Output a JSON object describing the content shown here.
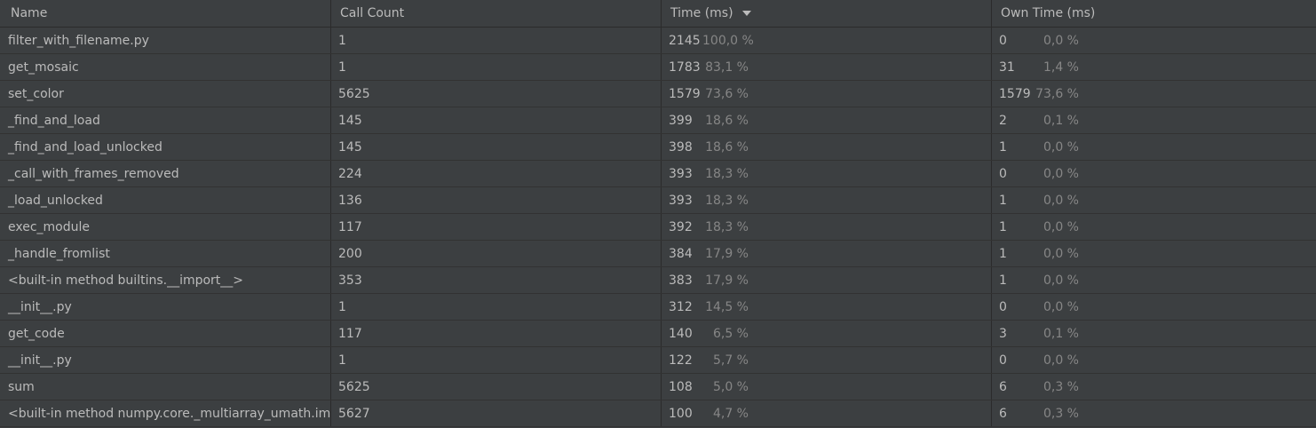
{
  "header": {
    "name": "Name",
    "call_count": "Call Count",
    "time": "Time (ms)",
    "own_time": "Own Time (ms)",
    "sort_icon": "sort-descending-icon"
  },
  "rows": [
    {
      "name": "filter_with_filename.py",
      "call_count": "1",
      "time": "2145",
      "time_pct": "100,0 %",
      "own": "0",
      "own_pct": "0,0 %"
    },
    {
      "name": "get_mosaic",
      "call_count": "1",
      "time": "1783",
      "time_pct": "83,1 %",
      "own": "31",
      "own_pct": "1,4 %"
    },
    {
      "name": "set_color",
      "call_count": "5625",
      "time": "1579",
      "time_pct": "73,6 %",
      "own": "1579",
      "own_pct": "73,6 %"
    },
    {
      "name": "_find_and_load",
      "call_count": "145",
      "time": "399",
      "time_pct": "18,6 %",
      "own": "2",
      "own_pct": "0,1 %"
    },
    {
      "name": "_find_and_load_unlocked",
      "call_count": "145",
      "time": "398",
      "time_pct": "18,6 %",
      "own": "1",
      "own_pct": "0,0 %"
    },
    {
      "name": "_call_with_frames_removed",
      "call_count": "224",
      "time": "393",
      "time_pct": "18,3 %",
      "own": "0",
      "own_pct": "0,0 %"
    },
    {
      "name": "_load_unlocked",
      "call_count": "136",
      "time": "393",
      "time_pct": "18,3 %",
      "own": "1",
      "own_pct": "0,0 %"
    },
    {
      "name": "exec_module",
      "call_count": "117",
      "time": "392",
      "time_pct": "18,3 %",
      "own": "1",
      "own_pct": "0,0 %"
    },
    {
      "name": "_handle_fromlist",
      "call_count": "200",
      "time": "384",
      "time_pct": "17,9 %",
      "own": "1",
      "own_pct": "0,0 %"
    },
    {
      "name": "<built-in method builtins.__import__>",
      "call_count": "353",
      "time": "383",
      "time_pct": "17,9 %",
      "own": "1",
      "own_pct": "0,0 %"
    },
    {
      "name": "__init__.py",
      "call_count": "1",
      "time": "312",
      "time_pct": "14,5 %",
      "own": "0",
      "own_pct": "0,0 %"
    },
    {
      "name": "get_code",
      "call_count": "117",
      "time": "140",
      "time_pct": "6,5 %",
      "own": "3",
      "own_pct": "0,1 %"
    },
    {
      "name": "__init__.py",
      "call_count": "1",
      "time": "122",
      "time_pct": "5,7 %",
      "own": "0",
      "own_pct": "0,0 %"
    },
    {
      "name": "sum",
      "call_count": "5625",
      "time": "108",
      "time_pct": "5,0 %",
      "own": "6",
      "own_pct": "0,3 %"
    },
    {
      "name": "<built-in method numpy.core._multiarray_umath.implement_array_function>",
      "call_count": "5627",
      "time": "100",
      "time_pct": "4,7 %",
      "own": "6",
      "own_pct": "0,3 %"
    }
  ],
  "colors": {
    "background": "#3c3f41",
    "grid": "#2b2b2b",
    "text": "#bbbbbb",
    "muted": "#868686"
  }
}
